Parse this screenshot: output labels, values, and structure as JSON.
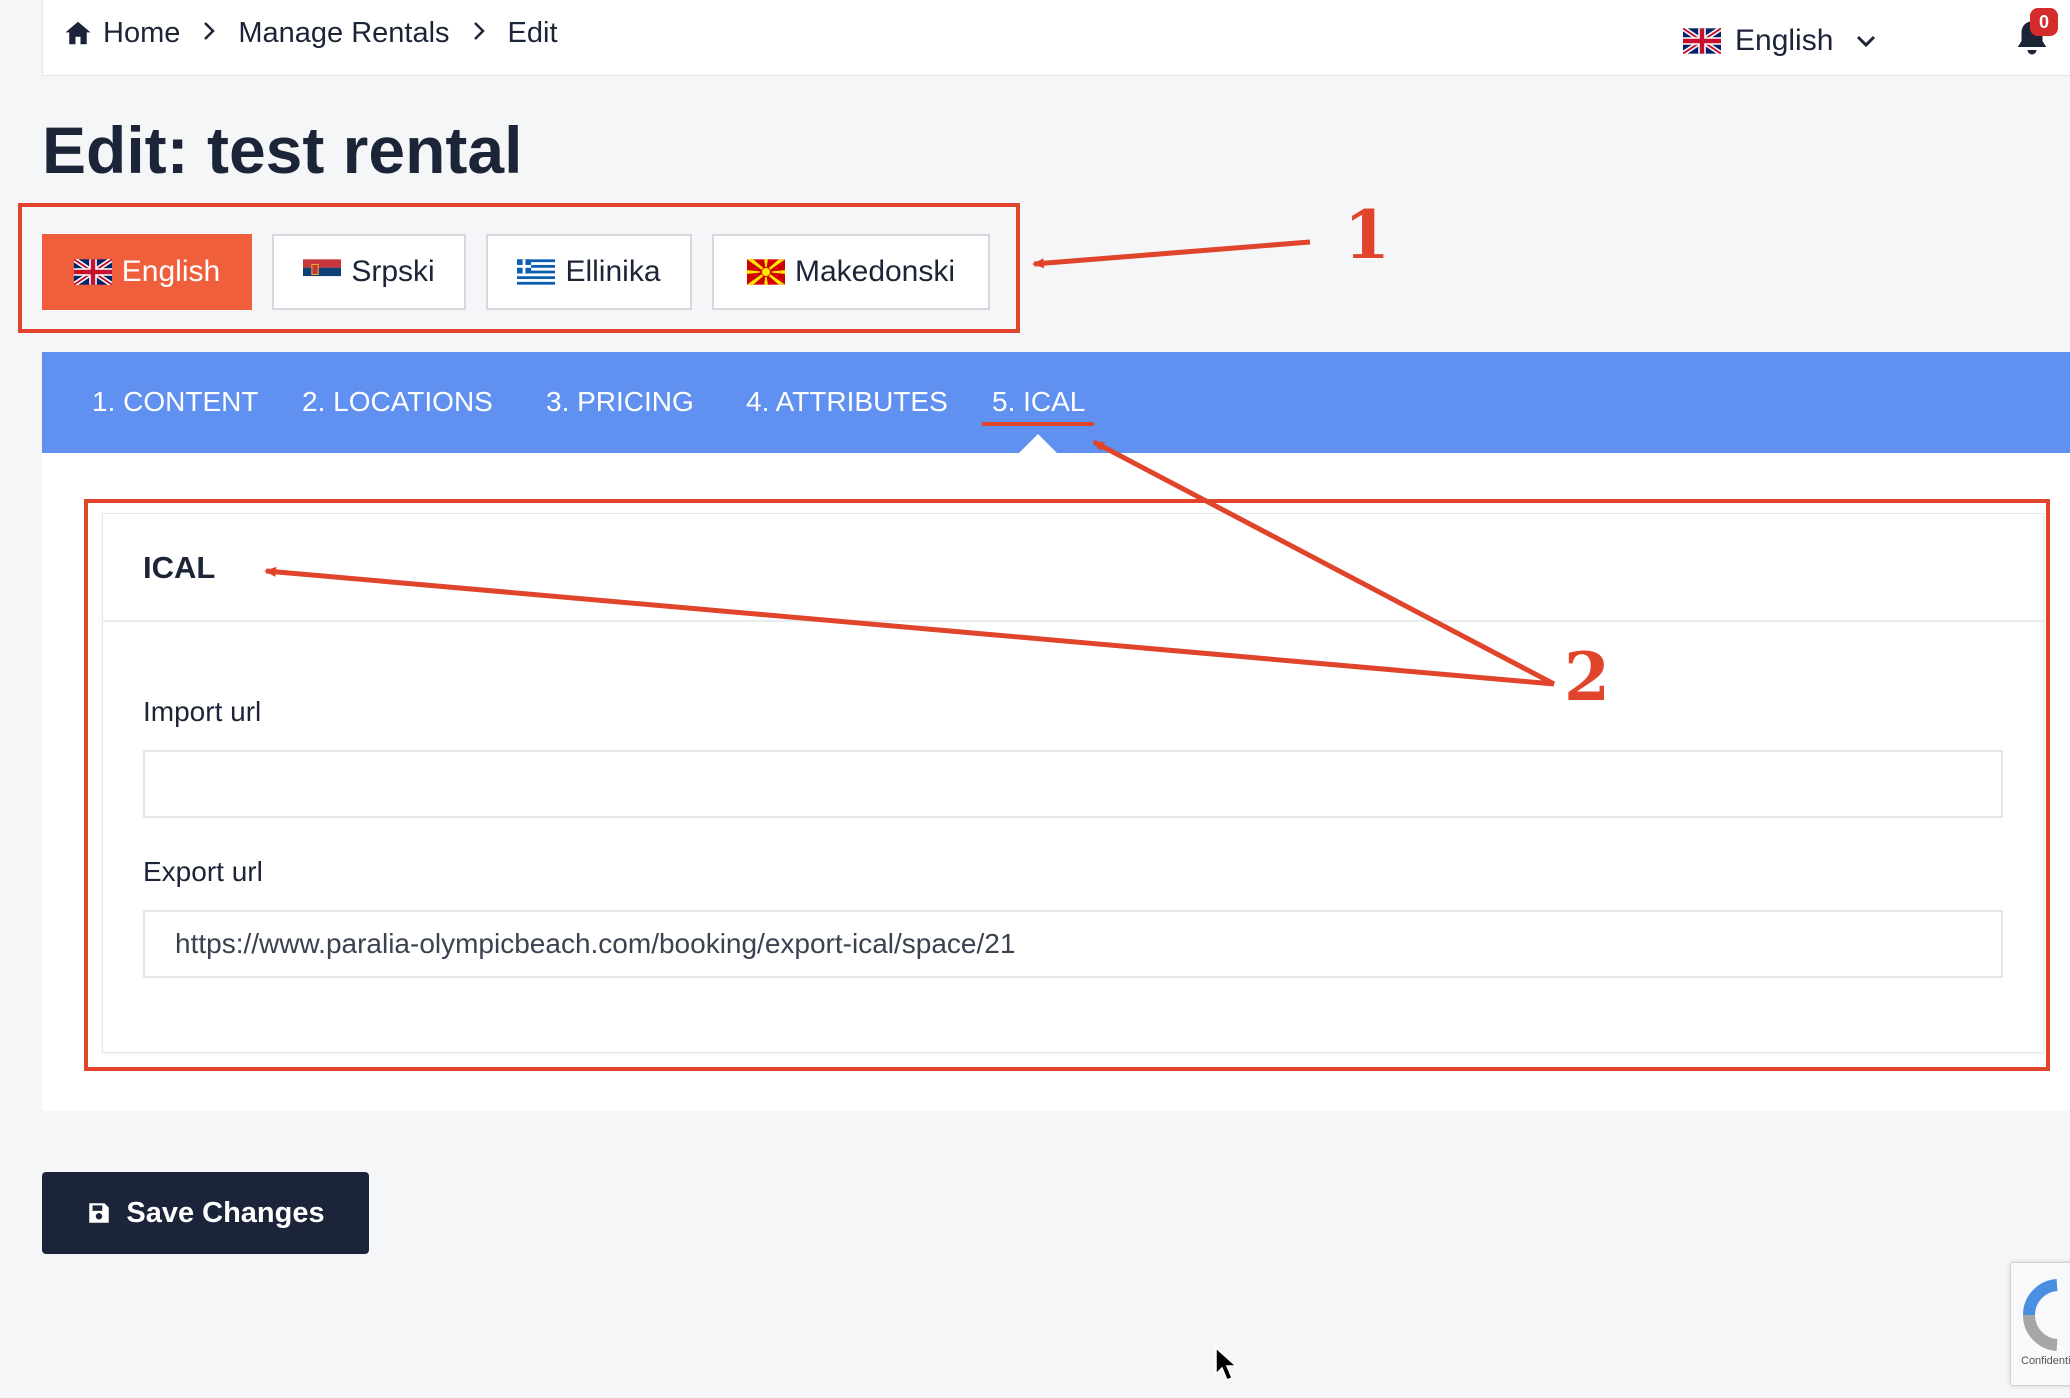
{
  "breadcrumb": {
    "home": "Home",
    "manage": "Manage Rentals",
    "current": "Edit"
  },
  "header": {
    "language": "English",
    "notifications_count": "0"
  },
  "page": {
    "title": "Edit: test rental"
  },
  "language_tabs": [
    {
      "label": "English",
      "flag": "uk-flag",
      "active": true
    },
    {
      "label": "Srpski",
      "flag": "serbia-flag",
      "active": false
    },
    {
      "label": "Ellinika",
      "flag": "greece-flag",
      "active": false
    },
    {
      "label": "Makedonski",
      "flag": "macedonia-flag",
      "active": false
    }
  ],
  "main_tabs": [
    {
      "label": "1. CONTENT"
    },
    {
      "label": "2. LOCATIONS"
    },
    {
      "label": "3. PRICING"
    },
    {
      "label": "4. ATTRIBUTES"
    },
    {
      "label": "5. ICAL",
      "active": true
    }
  ],
  "ical": {
    "title": "ICAL",
    "import_label": "Import url",
    "import_value": "",
    "export_label": "Export url",
    "export_value": "https://www.paralia-olympicbeach.com/booking/export-ical/space/21"
  },
  "actions": {
    "save_label": "Save Changes"
  },
  "recaptcha": {
    "text": "Confidentiality"
  },
  "annotations": {
    "label_one": "1",
    "label_two": "2"
  },
  "colors": {
    "accent": "#ef5f3c",
    "tabs_bg": "#6090f0",
    "dark": "#1b2438",
    "annotation": "#e0442b"
  }
}
